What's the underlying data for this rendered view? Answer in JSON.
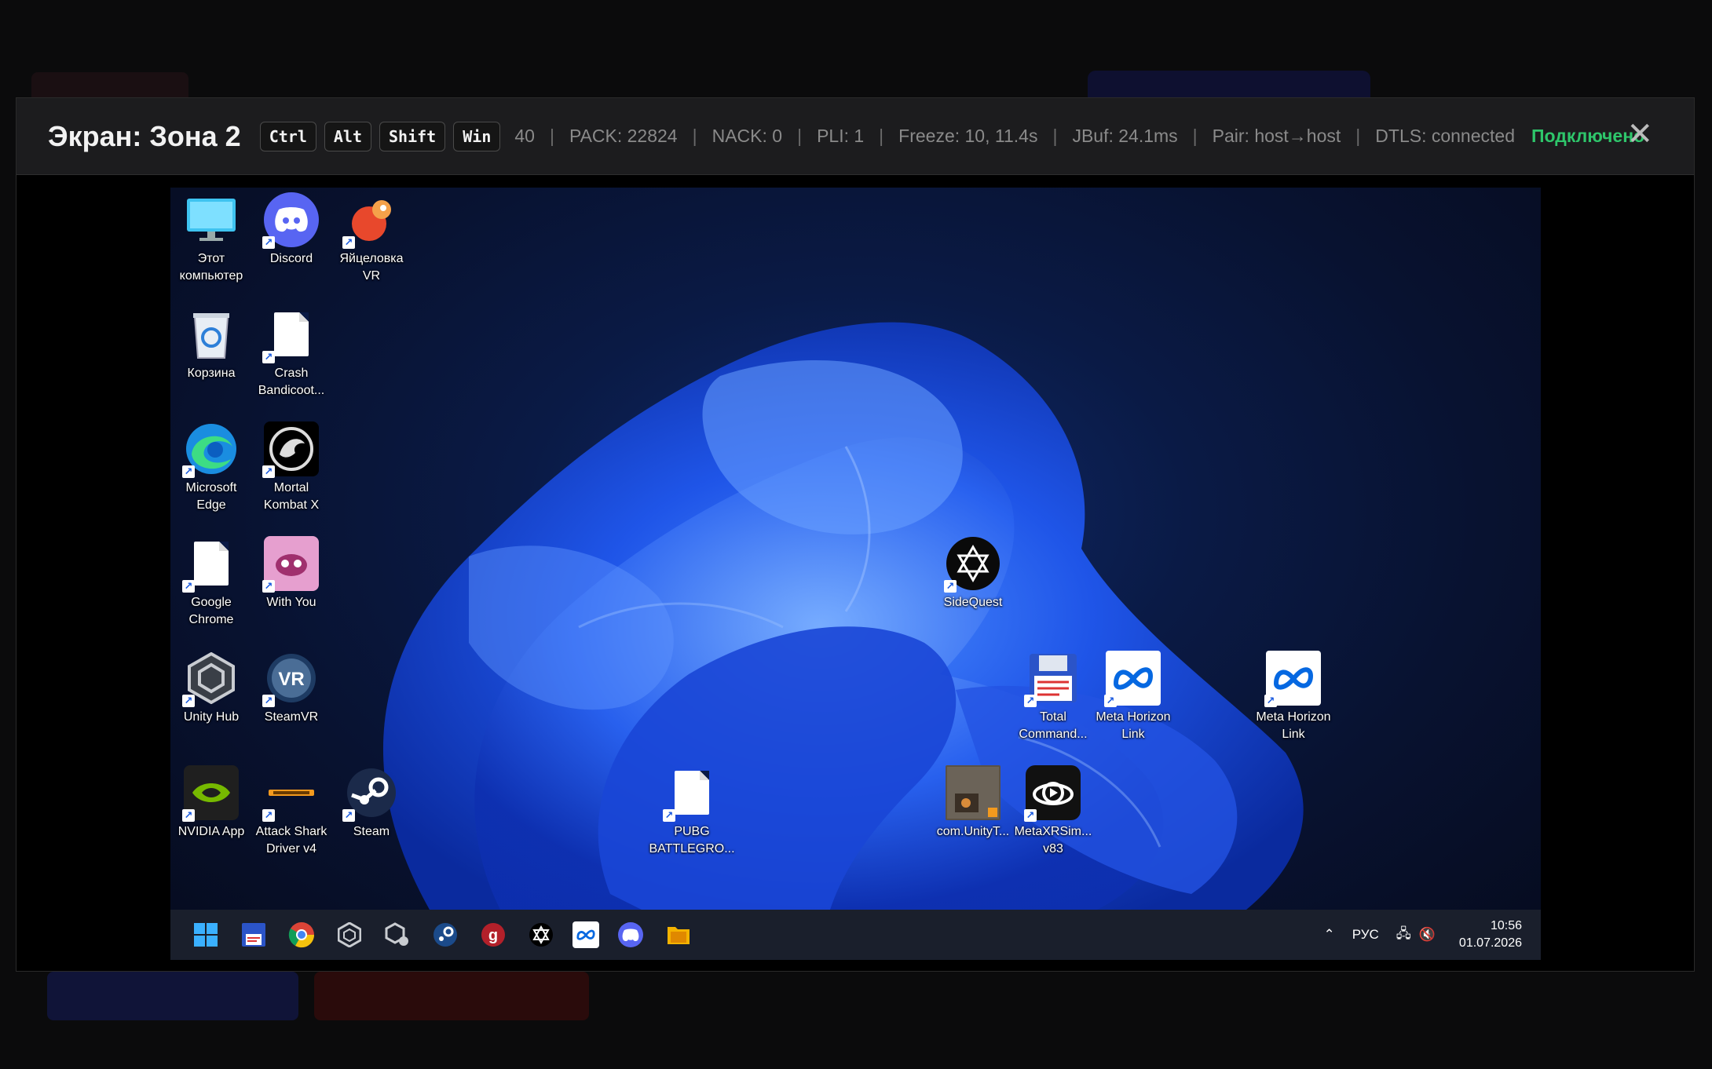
{
  "header": {
    "title": "Экран: Зона 2",
    "keys": [
      "Ctrl",
      "Alt",
      "Shift",
      "Win"
    ],
    "stats": [
      "40",
      "PACK: 22824",
      "NACK: 0",
      "PLI: 1",
      "Freeze: 10, 11.4s",
      "JBuf: 24.1ms",
      "Pair: host→host",
      "DTLS: connected"
    ],
    "status": "Подключено",
    "status_color": "#2ec66b",
    "close_symbol": "✕"
  },
  "desktop": {
    "icons": [
      {
        "label": "Этот компьютер",
        "icon": "monitor-icon"
      },
      {
        "label": "Discord",
        "icon": "discord-icon"
      },
      {
        "label": "Яйцеловка VR",
        "icon": "egg-game-icon"
      },
      {
        "label": "Корзина",
        "icon": "recycle-bin-icon"
      },
      {
        "label": "Crash Bandicoot...",
        "icon": "blank-file-icon"
      },
      {
        "label": "Microsoft Edge",
        "icon": "edge-icon"
      },
      {
        "label": "Mortal Kombat X",
        "icon": "mortal-kombat-icon"
      },
      {
        "label": "Google Chrome",
        "icon": "blank-file-icon"
      },
      {
        "label": "With You",
        "icon": "with-you-icon"
      },
      {
        "label": "Unity Hub",
        "icon": "unity-icon"
      },
      {
        "label": "SteamVR",
        "icon": "steamvr-icon"
      },
      {
        "label": "NVIDIA App",
        "icon": "nvidia-icon"
      },
      {
        "label": "Attack Shark Driver v4",
        "icon": "attack-shark-icon"
      },
      {
        "label": "Steam",
        "icon": "steam-icon"
      },
      {
        "label": "PUBG BATTLEGRO...",
        "icon": "blank-file-icon"
      },
      {
        "label": "SideQuest",
        "icon": "sidequest-icon"
      },
      {
        "label": "Total Command...",
        "icon": "floppy-icon"
      },
      {
        "label": "Meta Horizon Link",
        "icon": "meta-icon"
      },
      {
        "label": "Meta Horizon Link",
        "icon": "meta-icon"
      },
      {
        "label": "com.UnityT...",
        "icon": "video-thumbnail-icon"
      },
      {
        "label": "MetaXRSim... v83",
        "icon": "meta-xr-sim-icon"
      }
    ]
  },
  "taskbar": {
    "apps": [
      "windows-start-icon",
      "floppy-icon",
      "chrome-icon",
      "unity-icon",
      "unity-settings-icon",
      "steam-icon",
      "app-red-icon",
      "sidequest-icon",
      "meta-icon",
      "discord-icon",
      "folder-icon"
    ],
    "language": "РУС",
    "time": "10:56",
    "date": "01.07.2026"
  }
}
